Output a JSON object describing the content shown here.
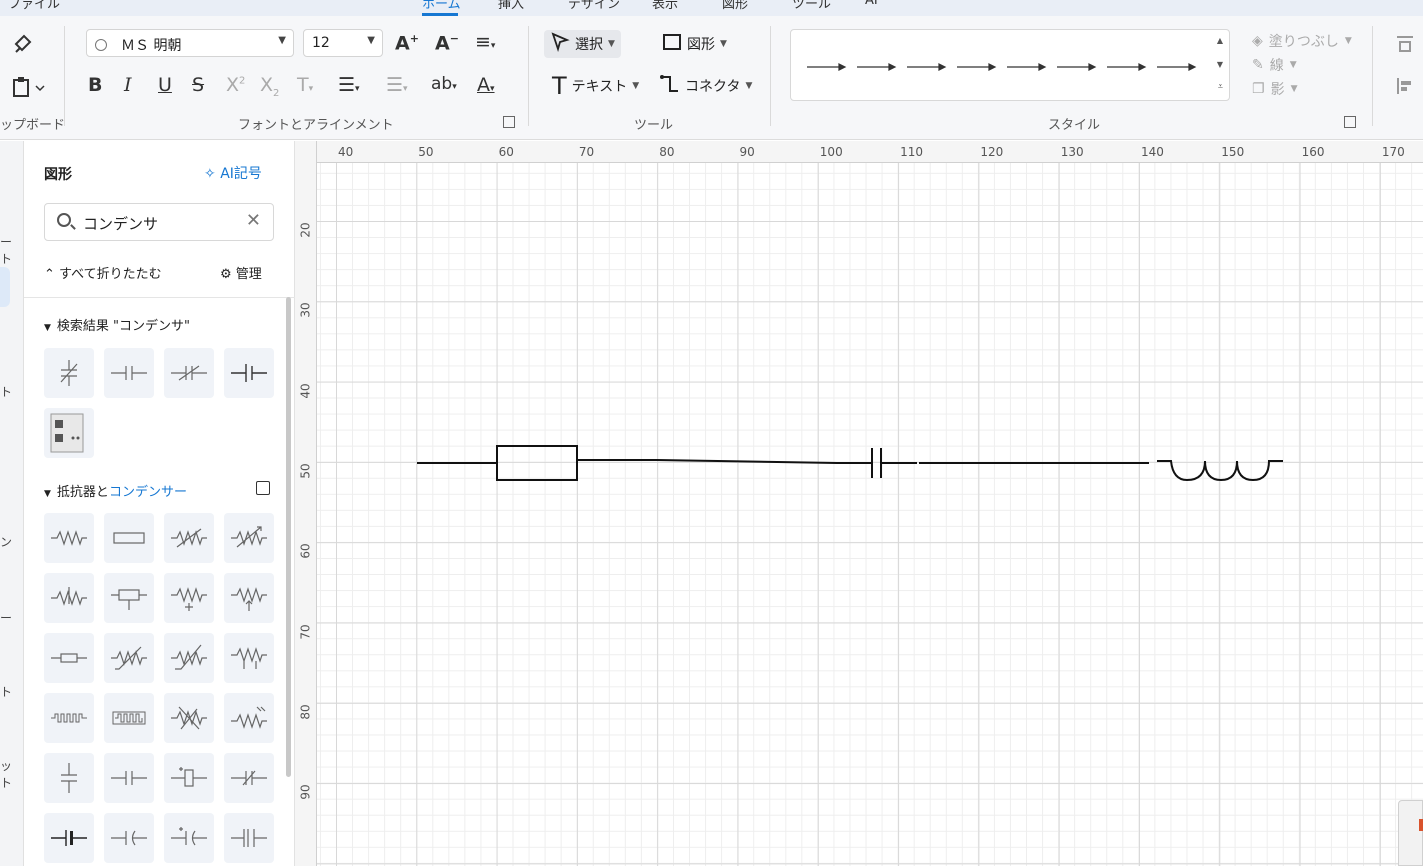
{
  "top_menu": {
    "items": [
      "ファイル",
      "ホーム",
      "挿入",
      "デザイン",
      "表示",
      "図形",
      "ツール",
      "AI"
    ],
    "active": "ホーム"
  },
  "ribbon": {
    "clipboard_label": "ップボード",
    "font": {
      "name": "ＭＳ 明朝",
      "size": "12",
      "group_label": "フォントとアラインメント"
    },
    "tools": {
      "select_label": "選択",
      "shape_label": "図形",
      "text_label": "テキスト",
      "connector_label": "コネクタ",
      "group_label": "ツール"
    },
    "style": {
      "group_label": "スタイル"
    },
    "props": {
      "fill_label": "塗りつぶし",
      "line_label": "線",
      "shadow_label": "影"
    }
  },
  "left_strip": [
    "ート",
    "ト",
    "ン",
    "ー",
    "ト",
    "ット"
  ],
  "panel": {
    "title": "図形",
    "ai_button": "AI記号",
    "search": {
      "value": "コンデンサ",
      "clear": "✕"
    },
    "collapse_all": "すべて折りたたむ",
    "manage": "管理",
    "search_results": {
      "prefix": "検索結果 \"コンデンサ\""
    },
    "library": {
      "prefix": "抵抗器と",
      "highlight": "コンデンサー"
    }
  },
  "rulers": {
    "horizontal": [
      "40",
      "50",
      "60",
      "70",
      "80",
      "90",
      "100",
      "110",
      "120",
      "130",
      "140",
      "150",
      "160",
      "170"
    ],
    "vertical": [
      "20",
      "30",
      "40",
      "50",
      "60",
      "70",
      "80",
      "90"
    ]
  },
  "colors": {
    "accent": "#1677d2",
    "ribbon_bg": "#f6f7f9",
    "grid_major": "#d8d8d8",
    "grid_minor": "#eeeeee"
  }
}
